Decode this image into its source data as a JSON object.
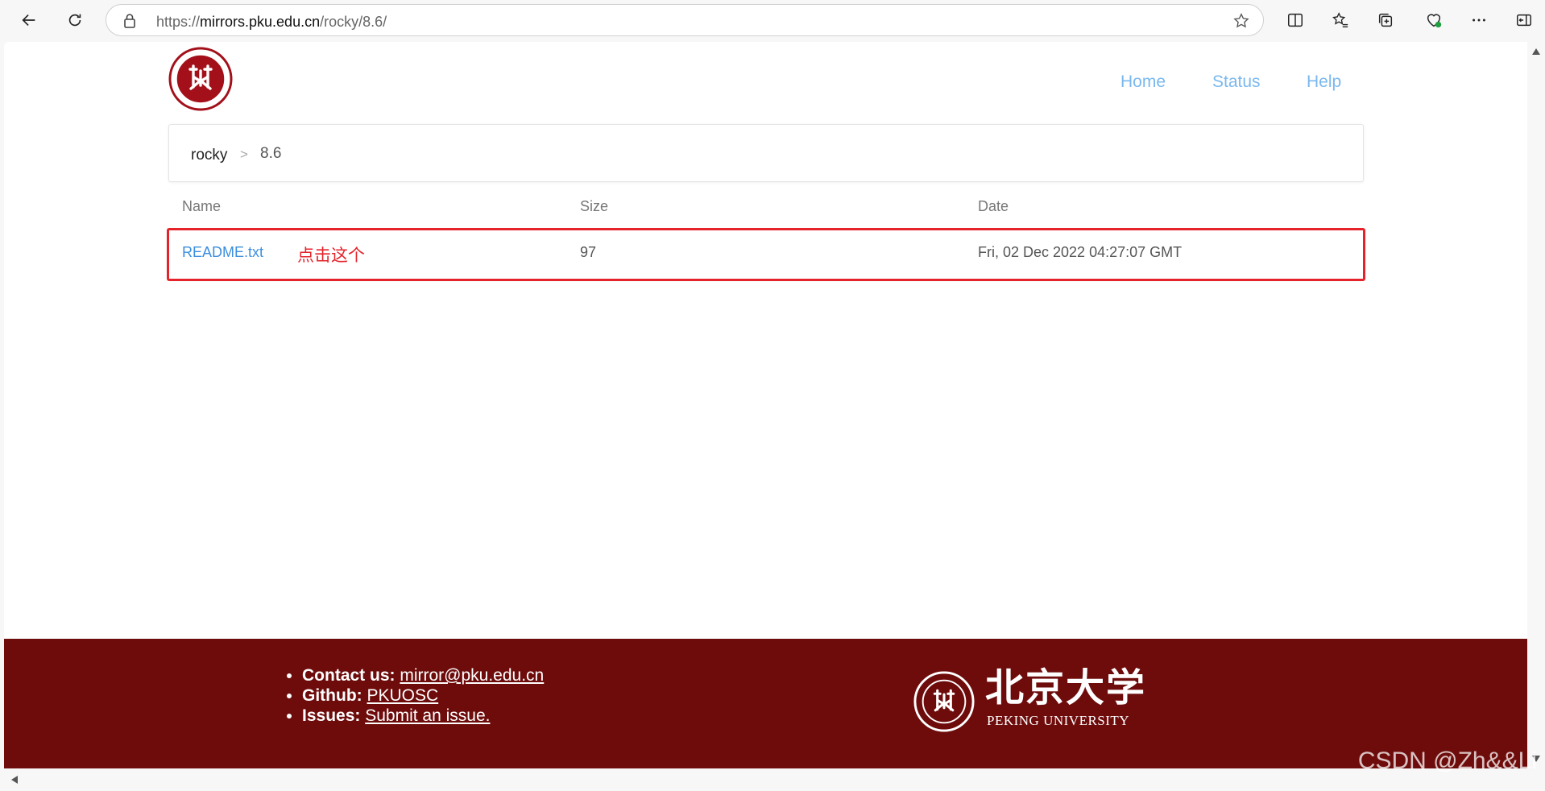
{
  "browser": {
    "url_prefix": "https://",
    "url_host": "mirrors.pku.edu.cn",
    "url_path": "/rocky/8.6/"
  },
  "nav": {
    "home": "Home",
    "status": "Status",
    "help": "Help"
  },
  "breadcrumb": {
    "root": "rocky",
    "separator": ">",
    "current": "8.6"
  },
  "table": {
    "headers": {
      "name": "Name",
      "size": "Size",
      "date": "Date"
    },
    "rows": [
      {
        "name": "README.txt",
        "size": "97",
        "date": "Fri, 02 Dec 2022 04:27:07 GMT"
      }
    ]
  },
  "annotation": "点击这个",
  "footer": {
    "contact_label": "Contact us:",
    "contact_value": "mirror@pku.edu.cn",
    "github_label": "Github:",
    "github_value": "PKUOSC",
    "issues_label": "Issues:",
    "issues_value": "Submit an issue.",
    "brand_cn": "北京大学",
    "brand_en": "PEKING UNIVERSITY"
  },
  "watermark": "CSDN @Zh&&Li",
  "colors": {
    "footer_bg": "#6e0c0c",
    "link": "#3b8fde",
    "nav_link": "#7ab8ee",
    "annotation": "#e5232b"
  }
}
